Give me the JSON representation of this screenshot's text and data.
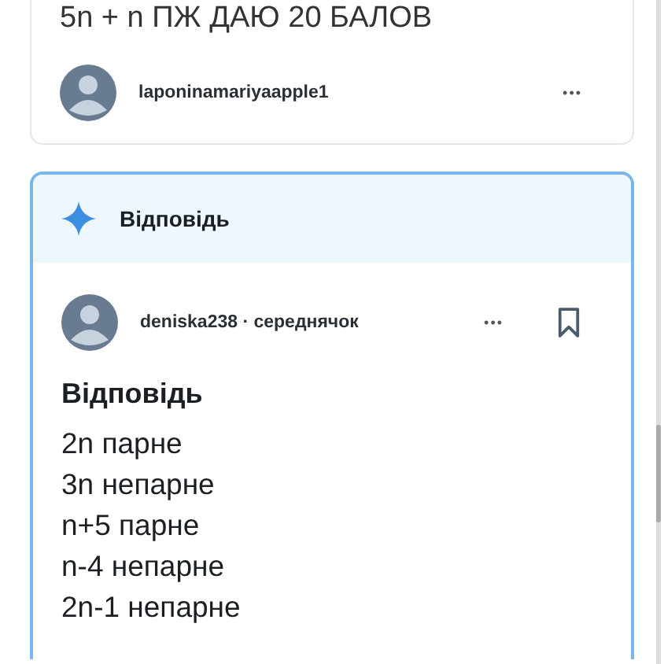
{
  "question": {
    "text": "5n + n ПЖ ДАЮ 20 БАЛОВ",
    "author": "laponinamariyaapple1",
    "more": "•••"
  },
  "answer_card": {
    "title": "Відповідь",
    "author": "deniska238 · середнячок",
    "more": "•••",
    "bookmarked": false,
    "heading": "Відповідь",
    "lines": [
      "2n парне",
      "3n непарне",
      "n+5 парне",
      "n-4 непарне",
      "2n-1 непарне"
    ]
  }
}
